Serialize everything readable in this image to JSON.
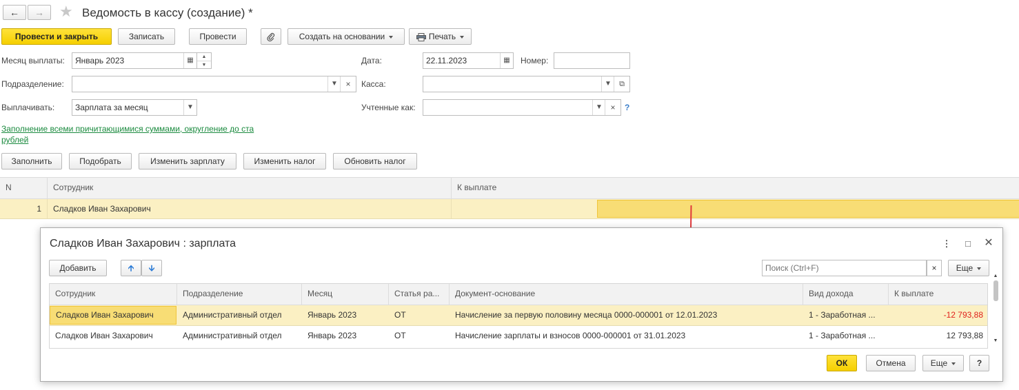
{
  "window": {
    "title": "Ведомость в кассу (создание) *"
  },
  "toolbar": {
    "post_close": "Провести и закрыть",
    "save": "Записать",
    "post": "Провести",
    "create_based": "Создать на основании",
    "print": "Печать"
  },
  "form": {
    "month_label": "Месяц выплаты:",
    "month_value": "Январь 2023",
    "date_label": "Дата:",
    "date_value": "22.11.2023",
    "number_label": "Номер:",
    "number_value": "",
    "dept_label": "Подразделение:",
    "dept_value": "",
    "cash_label": "Касса:",
    "cash_value": "",
    "pay_label": "Выплачивать:",
    "pay_value": "Зарплата за месяц",
    "accounted_label": "Учтенные как:",
    "accounted_value": "",
    "help": "?",
    "fill_link_line1": "Заполнение всеми причитающимися суммами, округление до ста",
    "fill_link_line2": "рублей"
  },
  "actions": {
    "fill": "Заполнить",
    "pick": "Подобрать",
    "change_salary": "Изменить зарплату",
    "change_tax": "Изменить налог",
    "update_tax": "Обновить налог"
  },
  "table": {
    "columns": [
      "N",
      "Сотрудник",
      "К выплате"
    ],
    "rows": [
      {
        "n": "1",
        "employee": "Сладков Иван Захарович",
        "amount": ""
      }
    ]
  },
  "dialog": {
    "title": "Сладков Иван Захарович : зарплата",
    "add": "Добавить",
    "search_placeholder": "Поиск (Ctrl+F)",
    "more": "Еще",
    "columns": [
      "Сотрудник",
      "Подразделение",
      "Месяц",
      "Статья ра...",
      "Документ-основание",
      "Вид дохода",
      "К выплате"
    ],
    "rows": [
      {
        "employee": "Сладков Иван Захарович",
        "dept": "Административный отдел",
        "month": "Январь 2023",
        "article": "ОТ",
        "doc": "Начисление за первую половину месяца 0000-000001 от 12.01.2023",
        "income": "1 - Заработная ...",
        "amount": "-12 793,88"
      },
      {
        "employee": "Сладков Иван Захарович",
        "dept": "Административный отдел",
        "month": "Январь 2023",
        "article": "ОТ",
        "doc": "Начисление зарплаты и взносов 0000-000001 от 31.01.2023",
        "income": "1 - Заработная ...",
        "amount": "12 793,88"
      }
    ],
    "ok": "ОК",
    "cancel": "Отмена",
    "more2": "Еще",
    "help": "?"
  },
  "colors": {
    "accent": "#f5cf00",
    "selected_row": "#fbf0c3",
    "negative": "#e0201b",
    "link": "#1a8a3e"
  }
}
